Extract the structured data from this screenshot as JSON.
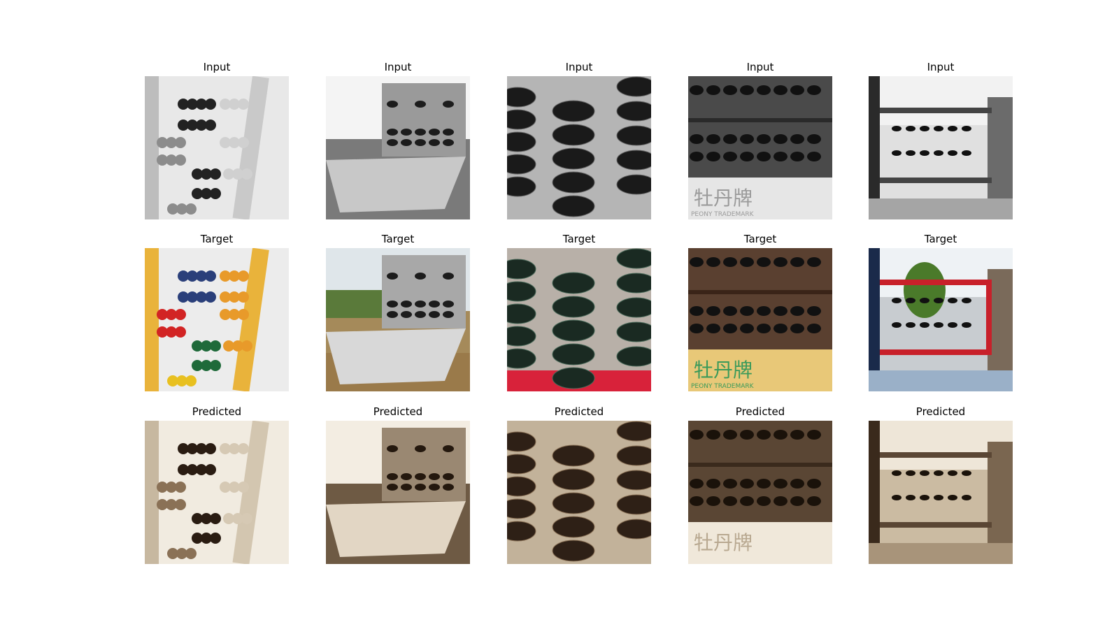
{
  "rows": [
    {
      "title": "Input",
      "tone": "gray"
    },
    {
      "title": "Target",
      "tone": "color"
    },
    {
      "title": "Predicted",
      "tone": "sepia"
    }
  ],
  "columns": [
    {
      "subject": "toy abacus with bead rows"
    },
    {
      "subject": "laptop-shaped abacus sculpture outdoors"
    },
    {
      "subject": "close-up of stacked abacus beads"
    },
    {
      "subject": "abacus frame with printed label below"
    },
    {
      "subject": "large outdoor abacus with red frame"
    }
  ],
  "label_glyphs": [
    "牡丹牌",
    "PEONY TRADEMARK"
  ],
  "palette": {
    "gray_bg": "#e6e6e6",
    "gray_dark": "#1e1e1e",
    "gray_mid": "#8a8a8a",
    "color_yellow": "#e9b33b",
    "color_blue": "#2a3f7a",
    "color_red": "#d22424",
    "color_green": "#1f6a3a",
    "color_frame_red": "#c8202a",
    "sepia_bg": "#efe7d8",
    "sepia_dark": "#3a2a1c",
    "sepia_mid": "#8a7156"
  }
}
